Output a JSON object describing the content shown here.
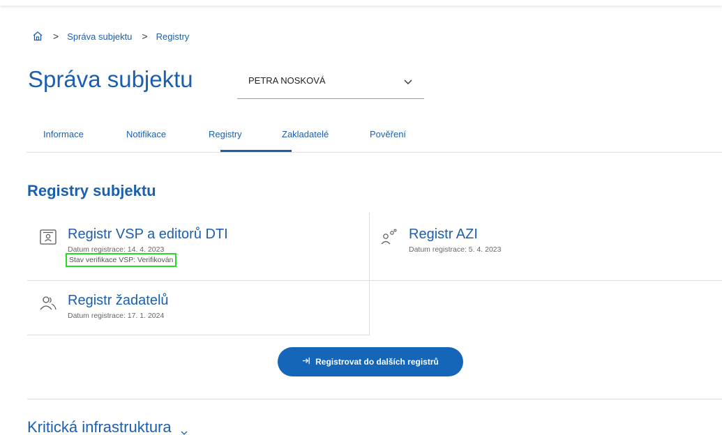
{
  "breadcrumb": {
    "home_icon": "home-icon",
    "items": [
      "Správa subjektu",
      "Registry"
    ]
  },
  "page": {
    "title": "Správa subjektu"
  },
  "subject_select": {
    "value": "PETRA NOSKOVÁ",
    "icon": "chevron-down-icon"
  },
  "tabs": [
    {
      "label": "Informace"
    },
    {
      "label": "Notifikace"
    },
    {
      "label": "Registry",
      "active": true
    },
    {
      "label": "Zakladatelé"
    },
    {
      "label": "Pověření"
    }
  ],
  "section": {
    "title": "Registry subjektu"
  },
  "registries": [
    {
      "name": "Registr VSP a editorů DTI",
      "date": "Datum registrace: 14. 4. 2023",
      "status": "Stav verifikace VSP: Verifikován",
      "icon": "id-card-icon"
    },
    {
      "name": "Registr AZI",
      "date": "Datum registrace: 5. 4. 2023",
      "icon": "user-gear-icon"
    },
    {
      "name": "Registr žadatelů",
      "date": "Datum registrace: 17. 1. 2024",
      "icon": "users-icon"
    }
  ],
  "actions": {
    "register_more": "Registrovat do dalších registrů",
    "register_icon": "sign-in-arrow-icon"
  },
  "critical_infrastructure": {
    "title": "Kritická infrastruktura",
    "icon": "chevron-down-icon"
  },
  "colors": {
    "primary": "#1b5fae",
    "button": "#1566b9",
    "highlight": "#22dd22"
  }
}
